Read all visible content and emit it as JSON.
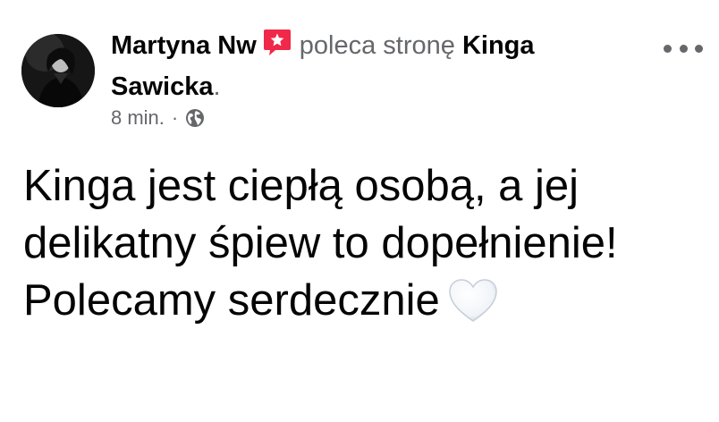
{
  "post": {
    "author_name": "Martyna Nw",
    "recommend_text": "poleca stronę",
    "page_name": "Kinga Sawicka",
    "period": ".",
    "time": "8 min.",
    "separator": "·",
    "privacy_icon": "globe-icon",
    "body_text": "Kinga jest ciepłą osobą, a jej delikatny śpiew to dopełnienie! Polecamy serdecznie",
    "emoji": "white-heart-icon",
    "badge_icon": "recommendation-star-icon",
    "menu_icon": "more-options-icon",
    "colors": {
      "primary_text": "#050505",
      "secondary_text": "#65676b",
      "badge": "#f02849"
    }
  }
}
